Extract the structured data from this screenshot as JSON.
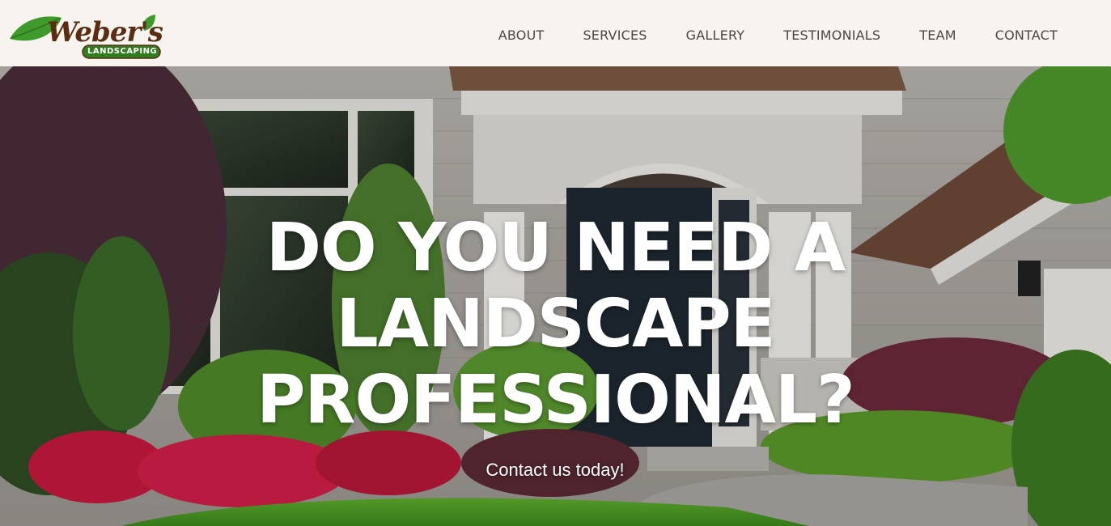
{
  "brand": {
    "logo_name": "Weber's",
    "logo_tag": "LANDSCAPING",
    "colors": {
      "leaf": "#3f9a2c",
      "wordmark": "#5a2d12",
      "tag_bg": "#2f7d1f"
    }
  },
  "nav": {
    "items": [
      {
        "label": "ABOUT"
      },
      {
        "label": "SERVICES"
      },
      {
        "label": "GALLERY"
      },
      {
        "label": "TESTIMONIALS"
      },
      {
        "label": "TEAM"
      },
      {
        "label": "CONTACT"
      }
    ]
  },
  "hero": {
    "headline_lines": [
      "DO YOU NEED A",
      "LANDSCAPE",
      "PROFESSIONAL?"
    ],
    "cta_text": "Contact us today!"
  },
  "theme": {
    "header_bg": "#f7f3ee",
    "nav_text": "#4a4744",
    "hero_text": "#ffffff"
  }
}
